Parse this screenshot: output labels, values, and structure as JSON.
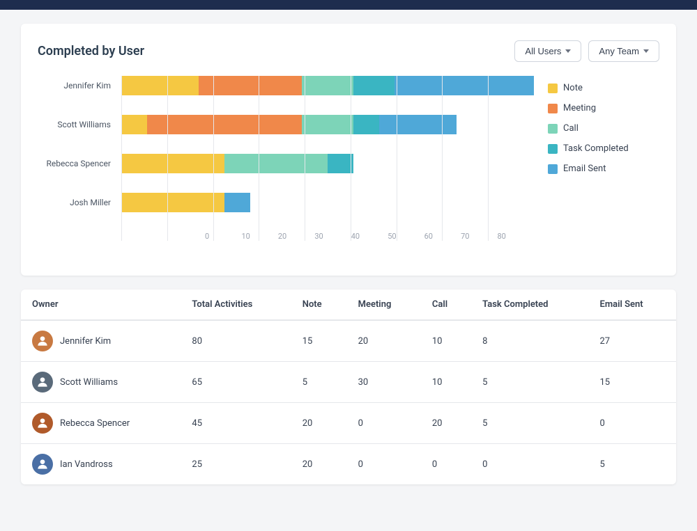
{
  "topbar": {},
  "header": {
    "title": "Completed by User",
    "filters": [
      {
        "label": "All Users",
        "id": "all-users-filter"
      },
      {
        "label": "Any Team",
        "id": "any-team-filter"
      }
    ]
  },
  "chart": {
    "bars": [
      {
        "name": "Jennifer Kim",
        "segments": [
          {
            "type": "note",
            "value": 15,
            "pct": 18.75
          },
          {
            "type": "meeting",
            "value": 20,
            "pct": 25
          },
          {
            "type": "call",
            "value": 10,
            "pct": 12.5
          },
          {
            "type": "task-completed",
            "value": 8,
            "pct": 10
          },
          {
            "type": "email-sent",
            "value": 27,
            "pct": 33.75
          }
        ]
      },
      {
        "name": "Scott Williams",
        "segments": [
          {
            "type": "note",
            "value": 5,
            "pct": 7.69
          },
          {
            "type": "meeting",
            "value": 30,
            "pct": 46.15
          },
          {
            "type": "call",
            "value": 10,
            "pct": 15.38
          },
          {
            "type": "task-completed",
            "value": 5,
            "pct": 7.69
          },
          {
            "type": "email-sent",
            "value": 15,
            "pct": 23.08
          }
        ]
      },
      {
        "name": "Rebecca Spencer",
        "segments": [
          {
            "type": "note",
            "value": 20,
            "pct": 44.44
          },
          {
            "type": "meeting",
            "value": 0,
            "pct": 0
          },
          {
            "type": "call",
            "value": 20,
            "pct": 44.44
          },
          {
            "type": "task-completed",
            "value": 5,
            "pct": 11.11
          },
          {
            "type": "email-sent",
            "value": 0,
            "pct": 0
          }
        ]
      },
      {
        "name": "Josh Miller",
        "segments": [
          {
            "type": "note",
            "value": 20,
            "pct": 80
          },
          {
            "type": "meeting",
            "value": 0,
            "pct": 0
          },
          {
            "type": "call",
            "value": 0,
            "pct": 0
          },
          {
            "type": "task-completed",
            "value": 0,
            "pct": 0
          },
          {
            "type": "email-sent",
            "value": 5,
            "pct": 20
          }
        ]
      }
    ],
    "xTicks": [
      "0",
      "10",
      "20",
      "30",
      "40",
      "50",
      "60",
      "70",
      "80"
    ],
    "maxValue": 80,
    "legend": [
      {
        "label": "Note",
        "class": "note",
        "color": "#f5c842"
      },
      {
        "label": "Meeting",
        "class": "meeting",
        "color": "#f0884a"
      },
      {
        "label": "Call",
        "class": "call",
        "color": "#7dd4b8"
      },
      {
        "label": "Task Completed",
        "class": "task-completed",
        "color": "#3ab5c2"
      },
      {
        "label": "Email Sent",
        "class": "email-sent",
        "color": "#4fa8d8"
      }
    ]
  },
  "table": {
    "columns": [
      "Owner",
      "Total Activities",
      "Note",
      "Meeting",
      "Call",
      "Task Completed",
      "Email Sent"
    ],
    "rows": [
      {
        "owner": "Jennifer Kim",
        "avatar_color": "#b87333",
        "total": "80",
        "note": "15",
        "meeting": "20",
        "call": "10",
        "task_completed": "8",
        "email_sent": "27"
      },
      {
        "owner": "Scott Williams",
        "avatar_color": "#5a6a7a",
        "total": "65",
        "note": "5",
        "meeting": "30",
        "call": "10",
        "task_completed": "5",
        "email_sent": "15"
      },
      {
        "owner": "Rebecca Spencer",
        "avatar_color": "#8b4513",
        "total": "45",
        "note": "20",
        "meeting": "0",
        "call": "20",
        "task_completed": "5",
        "email_sent": "0"
      },
      {
        "owner": "Ian Vandross",
        "avatar_color": "#4a6fa5",
        "total": "25",
        "note": "20",
        "meeting": "0",
        "call": "0",
        "task_completed": "0",
        "email_sent": "5"
      }
    ]
  }
}
